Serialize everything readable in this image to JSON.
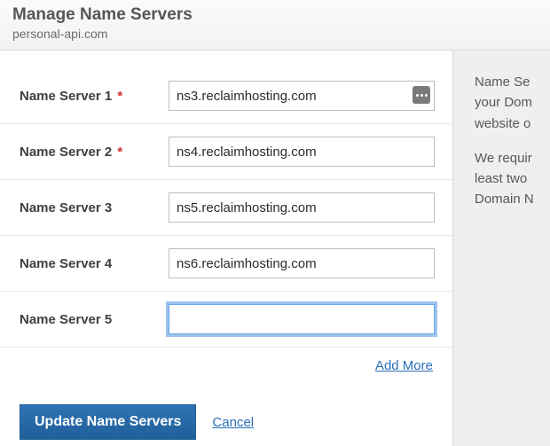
{
  "header": {
    "title": "Manage Name Servers",
    "domain": "personal-api.com"
  },
  "sidebar": {
    "para1_line1": "Name Se",
    "para1_line2": "your Dom",
    "para1_line3": "website o",
    "para2_line1": "We requir",
    "para2_line2": "least two",
    "para2_line3": "Domain N"
  },
  "fields": [
    {
      "label": "Name Server 1",
      "required": true,
      "value": "ns3.reclaimhosting.com",
      "hasBadge": true,
      "focused": false
    },
    {
      "label": "Name Server 2",
      "required": true,
      "value": "ns4.reclaimhosting.com",
      "hasBadge": false,
      "focused": false
    },
    {
      "label": "Name Server 3",
      "required": false,
      "value": "ns5.reclaimhosting.com",
      "hasBadge": false,
      "focused": false
    },
    {
      "label": "Name Server 4",
      "required": false,
      "value": "ns6.reclaimhosting.com",
      "hasBadge": false,
      "focused": false
    },
    {
      "label": "Name Server 5",
      "required": false,
      "value": "",
      "hasBadge": false,
      "focused": true
    }
  ],
  "links": {
    "addMore": "Add More",
    "cancel": "Cancel"
  },
  "buttons": {
    "update": "Update Name Servers"
  },
  "requiredMark": "*"
}
